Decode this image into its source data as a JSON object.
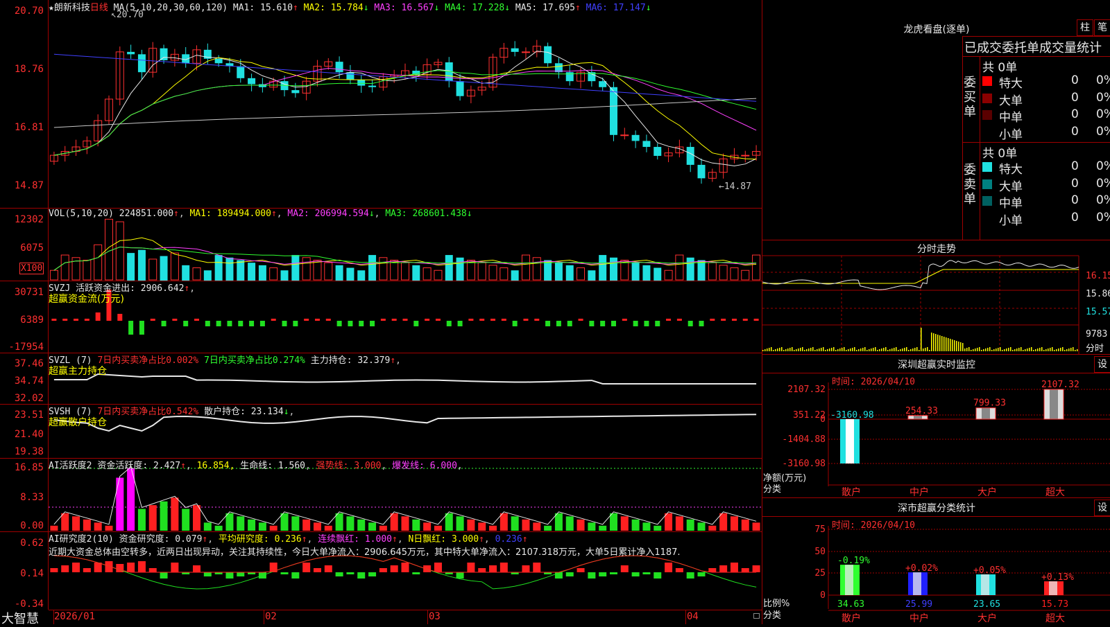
{
  "app": {
    "name": "大智慧"
  },
  "main": {
    "stock": "★朗新科技",
    "period": "日线",
    "ma_label": "MA(5,10,20,30,60,120)",
    "ma_values": [
      {
        "label": "MA1:",
        "value": "15.610",
        "arrow": "↑",
        "color": "#e8e8e8"
      },
      {
        "label": "MA2:",
        "value": "15.784",
        "arrow": "↓",
        "color": "#ffff00"
      },
      {
        "label": "MA3:",
        "value": "16.567",
        "arrow": "↓",
        "color": "#ff40ff"
      },
      {
        "label": "MA4:",
        "value": "17.228",
        "arrow": "↓",
        "color": "#30ff30"
      },
      {
        "label": "MA5:",
        "value": "17.695",
        "arrow": "↑",
        "color": "#e8e8e8"
      },
      {
        "label": "MA6:",
        "value": "17.147",
        "arrow": "↓",
        "color": "#4040ff"
      }
    ],
    "yticks": [
      "20.70",
      "18.76",
      "16.81",
      "14.87"
    ],
    "high_label": "20.70",
    "low_label": "14.87"
  },
  "vol": {
    "label": "VOL(5,10,20)",
    "value": "224851.000",
    "ma1": "189494.000",
    "ma2": "206994.594",
    "ma3": "268601.438",
    "yticks": [
      "12302",
      "6075"
    ],
    "unit": "X100"
  },
  "svzj": {
    "label": "SVZJ",
    "title": "活跃资金进出:",
    "value": "2906.642",
    "sub": "超赢资金流(万元)",
    "yticks": [
      "30731",
      "6389",
      "-17954"
    ]
  },
  "svzl": {
    "label": "SVZL (7)",
    "t1": "7日内买卖净占比0.002%",
    "t2": "7日内买卖净占比0.274%",
    "t3": "主力持仓:",
    "v3": "32.379",
    "sub": "超赢主力持仓",
    "yticks": [
      "37.46",
      "34.74",
      "32.02"
    ]
  },
  "svsh": {
    "label": "SVSH (7)",
    "t1": "7日内买卖净占比0.542%",
    "t3": "散户持仓:",
    "v3": "23.134",
    "sub": "超赢散户持仓",
    "yticks": [
      "23.51",
      "21.40",
      "19.38"
    ]
  },
  "ai1": {
    "label": "AI活跃度2",
    "t1": "资金活跃度:",
    "v1": "2.427",
    "v2": "16.854",
    "t3": "生命线:",
    "v3": "1.560",
    "t4": "强势线:",
    "v4": "3.000",
    "t5": "爆发线:",
    "v5": "6.000",
    "yticks": [
      "16.85",
      "8.33",
      "0.00"
    ]
  },
  "ai2": {
    "label": "AI研究度2(10)",
    "t1": "资金研究度:",
    "v1": "0.079",
    "t2": "平均研究度:",
    "v2": "0.236",
    "t3": "连续飘红:",
    "v3": "1.000",
    "t4": "N日飘红:",
    "v4": "3.000",
    "v5": "0.236",
    "comment": "近期大资金总体由空转多，近两日出现异动，关注其持续性，今日大单净流入：2906.645万元，其中特大单净流入：2107.318万元，大单5日累计净入1187.",
    "yticks": [
      "0.62",
      "0.14",
      "-0.34"
    ]
  },
  "xaxis": [
    "2026/01",
    "02",
    "03",
    "04"
  ],
  "right": {
    "dragon": {
      "title": "龙虎看盘(逐单)",
      "btn1": "柱",
      "btn2": "笔",
      "header": "已成交委托单成交量统计",
      "buy_label": "委买单",
      "sell_label": "委卖单",
      "buy_total": "共 0单",
      "sell_total": "共 0单",
      "buy_rows": [
        {
          "name": "特大",
          "count": "0",
          "pct": "0%",
          "color": "#ff0000"
        },
        {
          "name": "大单",
          "count": "0",
          "pct": "0%",
          "color": "#8b0000"
        },
        {
          "name": "中单",
          "count": "0",
          "pct": "0%",
          "color": "#5a0000"
        },
        {
          "name": "小单",
          "count": "0",
          "pct": "0%",
          "color": ""
        }
      ],
      "sell_rows": [
        {
          "name": "特大",
          "count": "0",
          "pct": "0%",
          "color": "#20e0e0"
        },
        {
          "name": "大单",
          "count": "0",
          "pct": "0%",
          "color": "#008080"
        },
        {
          "name": "中单",
          "count": "0",
          "pct": "0%",
          "color": "#006060"
        },
        {
          "name": "小单",
          "count": "0",
          "pct": "0%",
          "color": ""
        }
      ]
    },
    "intraday": {
      "title": "分时走势",
      "yticks": [
        "16.15",
        "15.86",
        "15.57",
        "9783"
      ],
      "yunit": "分时"
    },
    "monitor": {
      "title": "深圳超赢实时监控",
      "btn": "设",
      "time": "时间: 2026/04/10",
      "yticks": [
        "2107.32",
        "351.22",
        "0",
        "-1404.88",
        "-3160.98"
      ],
      "ylabel": "净额(万元)",
      "xlabel": "分类",
      "categories": [
        "散户",
        "中户",
        "大户",
        "超大"
      ],
      "values": [
        -3160.98,
        254.33,
        799.33,
        2107.32
      ],
      "value_labels": [
        "-3160.98",
        "254.33",
        "799.33",
        "2107.32"
      ]
    },
    "classify": {
      "title": "深市超赢分类统计",
      "btn": "设",
      "time": "时间: 2026/04/10",
      "yticks": [
        "75",
        "50",
        "25",
        "0"
      ],
      "ylabel": "比例%",
      "xlabel": "分类",
      "categories": [
        "散户",
        "中户",
        "大户",
        "超大"
      ],
      "values": [
        34.63,
        25.99,
        23.65,
        15.73
      ],
      "value_labels": [
        "34.63",
        "25.99",
        "23.65",
        "15.73"
      ],
      "changes": [
        "-0.19%",
        "+0.02%",
        "+0.05%",
        "+0.13%"
      ]
    }
  },
  "chart_data": {
    "type": "candlestick",
    "title": "朗新科技 日线",
    "ylim": [
      14.87,
      20.7
    ],
    "ohlc_close": [
      15.92,
      16.05,
      16.2,
      16.4,
      17.08,
      17.8,
      19.38,
      19.3,
      18.7,
      19.5,
      19.1,
      19.3,
      19.0,
      19.45,
      19.15,
      19.0,
      18.9,
      18.5,
      18.3,
      18.2,
      18.4,
      18.1,
      18.0,
      18.4,
      18.9,
      19.05,
      18.7,
      18.45,
      18.25,
      18.2,
      18.55,
      18.6,
      18.75,
      18.62,
      18.95,
      19.03,
      18.4,
      17.9,
      18.1,
      18.2,
      19.2,
      19.5,
      19.38,
      19.38,
      19.57,
      19.0,
      18.7,
      18.4,
      18.7,
      18.4,
      18.2,
      16.6,
      16.6,
      16.4,
      16.2,
      15.9,
      16.0,
      16.2,
      15.6,
      15.15,
      15.35,
      15.8,
      15.92,
      15.92,
      16.05
    ]
  }
}
